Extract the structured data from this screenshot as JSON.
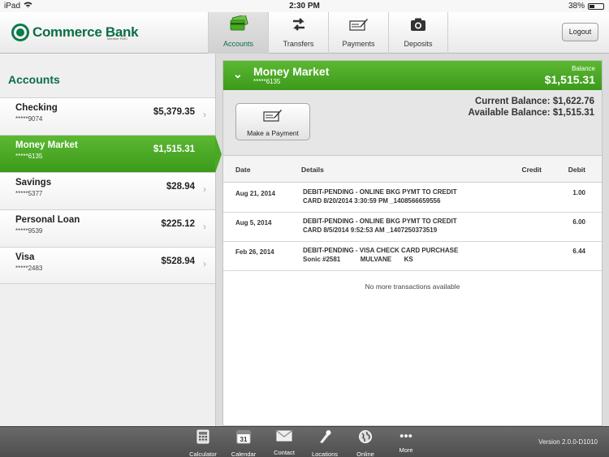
{
  "status": {
    "device": "iPad",
    "time": "2:30 PM",
    "battery": "38%",
    "battery_level": 0.38
  },
  "header": {
    "logo_text": "Commerce Bank",
    "logo_subtext": "Member FDIC",
    "tabs": [
      {
        "label": "Accounts",
        "icon": "cards-icon"
      },
      {
        "label": "Transfers",
        "icon": "transfer-arrows-icon"
      },
      {
        "label": "Payments",
        "icon": "check-sign-icon"
      },
      {
        "label": "Deposits",
        "icon": "camera-icon"
      }
    ],
    "logout_label": "Logout"
  },
  "sidebar": {
    "title": "Accounts",
    "accounts": [
      {
        "name": "Checking",
        "number": "*****9074",
        "amount": "$5,379.35"
      },
      {
        "name": "Money Market",
        "number": "*****6135",
        "amount": "$1,515.31"
      },
      {
        "name": "Savings",
        "number": "*****5377",
        "amount": "$28.94"
      },
      {
        "name": "Personal Loan",
        "number": "*****9539",
        "amount": "$225.12"
      },
      {
        "name": "Visa",
        "number": "*****2483",
        "amount": "$528.94"
      }
    ]
  },
  "detail": {
    "title": "Money Market",
    "number": "*****6135",
    "balance_label": "Balance",
    "balance": "$1,515.31",
    "make_payment_label": "Make a Payment",
    "current_balance": "Current Balance: $1,622.76",
    "available_balance": "Available Balance: $1,515.31",
    "columns": {
      "date": "Date",
      "details": "Details",
      "credit": "Credit",
      "debit": "Debit"
    },
    "transactions": [
      {
        "date": "Aug 21, 2014",
        "line1": "DEBIT-PENDING - ONLINE BKG PYMT TO CREDIT",
        "line2": "CARD 8/20/2014 3:30:59 PM _1408566659556",
        "credit": "",
        "debit": "1.00"
      },
      {
        "date": "Aug 5, 2014",
        "line1": "DEBIT-PENDING - ONLINE BKG PYMT TO CREDIT",
        "line2": "CARD 8/5/2014 9:52:53 AM _1407250373519",
        "credit": "",
        "debit": "6.00"
      },
      {
        "date": "Feb 26, 2014",
        "line1": "DEBIT-PENDING - VISA CHECK CARD PURCHASE",
        "line2": "Sonic #2581           MULVANE       KS",
        "credit": "",
        "debit": "6.44"
      }
    ],
    "no_more": "No more transactions available"
  },
  "bottom": {
    "tools": [
      {
        "label": "Calculator",
        "icon": "calculator-icon"
      },
      {
        "label": "Calendar",
        "icon": "calendar-icon",
        "badge": "31"
      },
      {
        "label": "Contact",
        "icon": "envelope-icon"
      },
      {
        "label": "Locations",
        "icon": "pin-icon"
      },
      {
        "label": "Online Banking",
        "icon": "globe-icon"
      },
      {
        "label": "More",
        "icon": "more-dots-icon"
      }
    ],
    "version": "Version 2.0.0-D1010"
  },
  "colors": {
    "brand_green": "#0b6e45",
    "selected_green": "#4aa924"
  }
}
